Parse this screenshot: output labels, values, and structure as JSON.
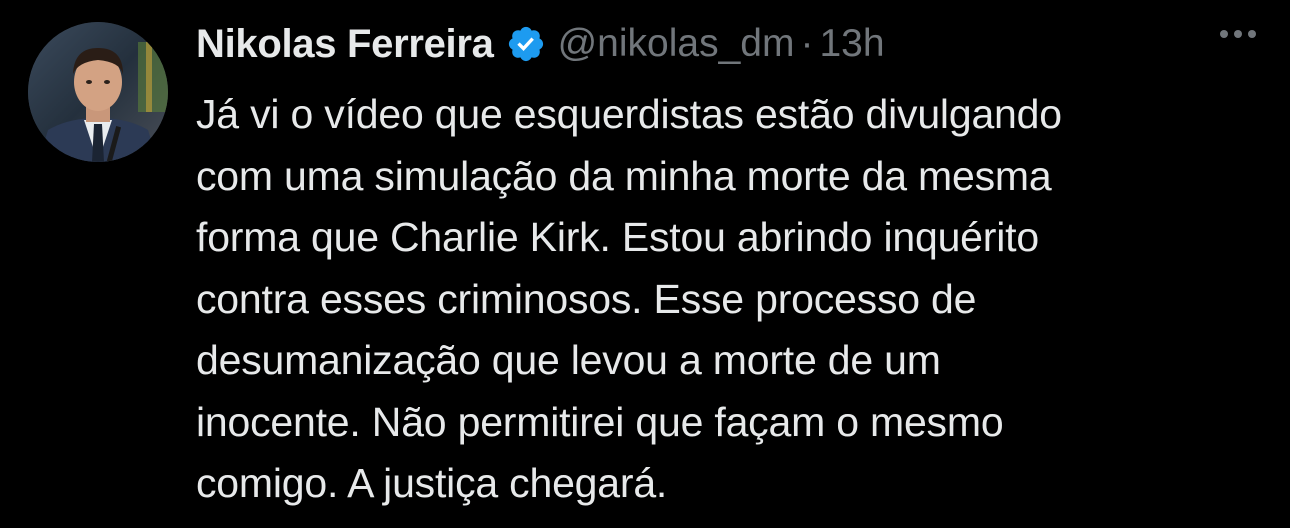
{
  "author": {
    "name": "Nikolas Ferreira",
    "handle": "@nikolas_dm",
    "separator": "·",
    "time": "13h",
    "verified_icon": "verified-badge-icon",
    "verified_color": "#1d9bf0"
  },
  "tweet": {
    "lines": [
      "Já vi o vídeo que esquerdistas estão divulgando",
      "com uma simulação da minha morte da mesma",
      "forma que Charlie Kirk. Estou abrindo inquérito",
      "contra esses criminosos. Esse processo de",
      "desumanização que levou a morte de um",
      "inocente. Não permitirei que façam o mesmo",
      "comigo. A justiça chegará."
    ]
  },
  "colors": {
    "background": "#000000",
    "text": "#e7e9ea",
    "secondary": "#71767b"
  }
}
